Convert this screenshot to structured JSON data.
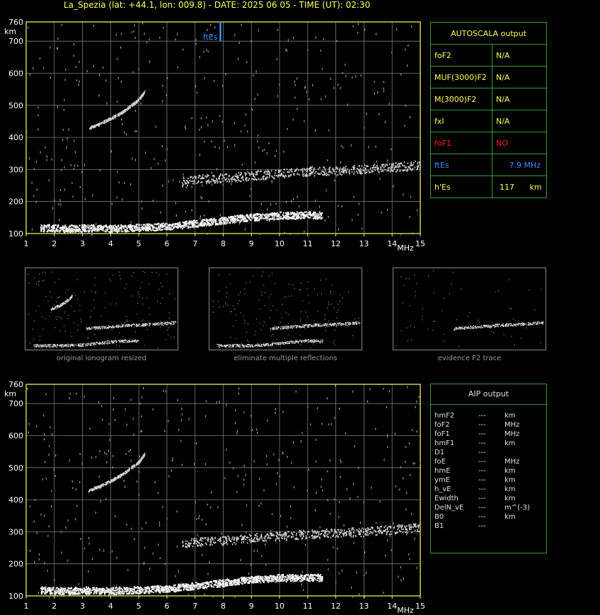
{
  "header": {
    "title": "La_Spezia (lat: +44.1, lon: 009.8) - DATE: 2025 06 05 - TIME (UT): 02:30"
  },
  "colors": {
    "axis": "#ffff66",
    "grid": "#7a7a7a",
    "panel_border": "#3a9a3a",
    "fbes_marker": "#3a8fff",
    "trace": "#ffffff"
  },
  "autoscala": {
    "title": "AUTOSCALA output",
    "rows": [
      {
        "label": "foF2",
        "value": "N/A",
        "unit": ""
      },
      {
        "label": "MUF(3000)F2",
        "value": "N/A",
        "unit": ""
      },
      {
        "label": "M(3000)F2",
        "value": "N/A",
        "unit": ""
      },
      {
        "label": "fxI",
        "value": "N/A",
        "unit": ""
      },
      {
        "label": "foF1",
        "value": "NO",
        "unit": ""
      },
      {
        "label": "ftEs",
        "value": "7.9 MHz",
        "unit": ""
      },
      {
        "label": "h'Es",
        "value": "117",
        "unit": "km"
      }
    ]
  },
  "aip": {
    "title": "AIP output",
    "rows": [
      {
        "param": "hmF2",
        "value": "---",
        "unit": "km"
      },
      {
        "param": "foF2",
        "value": "---",
        "unit": "MHz"
      },
      {
        "param": "foF1",
        "value": "---",
        "unit": "MHz"
      },
      {
        "param": "hmF1",
        "value": "---",
        "unit": "km"
      },
      {
        "param": "D1",
        "value": "---",
        "unit": ""
      },
      {
        "param": "foE",
        "value": "---",
        "unit": "MHz"
      },
      {
        "param": "hmE",
        "value": "---",
        "unit": "km"
      },
      {
        "param": "ymE",
        "value": "---",
        "unit": "km"
      },
      {
        "param": "h_vE",
        "value": "---",
        "unit": "km"
      },
      {
        "param": "Ewidth",
        "value": "---",
        "unit": "km"
      },
      {
        "param": "DelN_vE",
        "value": "---",
        "unit": "m^(-3)"
      },
      {
        "param": "B0",
        "value": "---",
        "unit": "km"
      },
      {
        "param": "B1",
        "value": "---",
        "unit": ""
      }
    ]
  },
  "thumbnails": [
    {
      "caption": "original ionogram resized"
    },
    {
      "caption": "eliminate multiple reflections"
    },
    {
      "caption": "evidence F2 trace"
    }
  ],
  "chart_data": [
    {
      "type": "scatter",
      "xlabel": "MHz",
      "ylabel": "km",
      "xlim": [
        1,
        15
      ],
      "ylim": [
        100,
        760
      ],
      "x_ticks": [
        1,
        2,
        3,
        4,
        5,
        6,
        7,
        8,
        9,
        10,
        11,
        12,
        13,
        14,
        15
      ],
      "y_ticks": [
        100,
        200,
        300,
        400,
        500,
        600,
        700,
        760
      ],
      "grid": true,
      "annotations": [
        {
          "text": "ftEs",
          "x": 7.9,
          "y": 700
        }
      ],
      "marker_ftEs": {
        "x": 7.9,
        "y_from": 700,
        "y_to": 760
      },
      "series": [
        {
          "kind": "Es-trace",
          "points": [
            [
              1.5,
              120
            ],
            [
              2,
              118
            ],
            [
              2.5,
              117
            ],
            [
              3,
              119
            ],
            [
              3.5,
              118
            ],
            [
              4,
              117
            ],
            [
              4.5,
              119
            ],
            [
              5,
              120
            ],
            [
              5.5,
              122
            ],
            [
              6,
              124
            ],
            [
              6.5,
              128
            ],
            [
              7,
              133
            ],
            [
              7.5,
              138
            ],
            [
              8,
              142
            ],
            [
              8.5,
              148
            ],
            [
              9,
              152
            ],
            [
              9.5,
              155
            ],
            [
              10,
              158
            ],
            [
              10.5,
              158
            ],
            [
              11,
              160
            ],
            [
              11.5,
              158
            ]
          ]
        },
        {
          "kind": "F-trace",
          "points": [
            [
              6.5,
              262
            ],
            [
              7,
              270
            ],
            [
              7.5,
              272
            ],
            [
              8,
              275
            ],
            [
              8.5,
              278
            ],
            [
              9,
              282
            ],
            [
              9.5,
              285
            ],
            [
              10,
              288
            ],
            [
              10.5,
              292
            ],
            [
              11,
              295
            ],
            [
              11.5,
              296
            ],
            [
              12,
              298
            ],
            [
              12.5,
              300
            ],
            [
              13,
              302
            ],
            [
              13.5,
              305
            ],
            [
              14,
              308
            ],
            [
              14.5,
              312
            ],
            [
              15,
              316
            ]
          ]
        },
        {
          "kind": "multiple-reflection",
          "points": [
            [
              3.2,
              430
            ],
            [
              3.5,
              440
            ],
            [
              3.8,
              452
            ],
            [
              4.1,
              465
            ],
            [
              4.4,
              480
            ],
            [
              4.7,
              500
            ],
            [
              5,
              520
            ],
            [
              5.2,
              545
            ]
          ]
        }
      ]
    },
    {
      "type": "scatter",
      "xlabel": "MHz",
      "ylabel": "km",
      "xlim": [
        1,
        15
      ],
      "ylim": [
        100,
        760
      ],
      "x_ticks": [
        1,
        2,
        3,
        4,
        5,
        6,
        7,
        8,
        9,
        10,
        11,
        12,
        13,
        14,
        15
      ],
      "y_ticks": [
        100,
        200,
        300,
        400,
        500,
        600,
        700,
        760
      ],
      "grid": true,
      "series": [
        {
          "kind": "Es-trace",
          "points": [
            [
              1.5,
              120
            ],
            [
              2,
              118
            ],
            [
              2.5,
              117
            ],
            [
              3,
              119
            ],
            [
              3.5,
              118
            ],
            [
              4,
              117
            ],
            [
              4.5,
              119
            ],
            [
              5,
              120
            ],
            [
              5.5,
              122
            ],
            [
              6,
              124
            ],
            [
              6.5,
              128
            ],
            [
              7,
              133
            ],
            [
              7.5,
              138
            ],
            [
              8,
              142
            ],
            [
              8.5,
              148
            ],
            [
              9,
              152
            ],
            [
              9.5,
              155
            ],
            [
              10,
              158
            ],
            [
              10.5,
              158
            ],
            [
              11,
              160
            ],
            [
              11.5,
              158
            ]
          ]
        },
        {
          "kind": "F-trace",
          "points": [
            [
              6.5,
              262
            ],
            [
              7,
              270
            ],
            [
              7.5,
              272
            ],
            [
              8,
              275
            ],
            [
              8.5,
              278
            ],
            [
              9,
              282
            ],
            [
              9.5,
              285
            ],
            [
              10,
              288
            ],
            [
              10.5,
              292
            ],
            [
              11,
              295
            ],
            [
              11.5,
              296
            ],
            [
              12,
              298
            ],
            [
              12.5,
              300
            ],
            [
              13,
              302
            ],
            [
              13.5,
              305
            ],
            [
              14,
              308
            ],
            [
              14.5,
              312
            ],
            [
              15,
              316
            ]
          ]
        },
        {
          "kind": "multiple-reflection",
          "points": [
            [
              3.2,
              430
            ],
            [
              3.5,
              440
            ],
            [
              3.8,
              452
            ],
            [
              4.1,
              465
            ],
            [
              4.4,
              480
            ],
            [
              4.7,
              500
            ],
            [
              5,
              520
            ],
            [
              5.2,
              545
            ]
          ]
        }
      ]
    }
  ]
}
